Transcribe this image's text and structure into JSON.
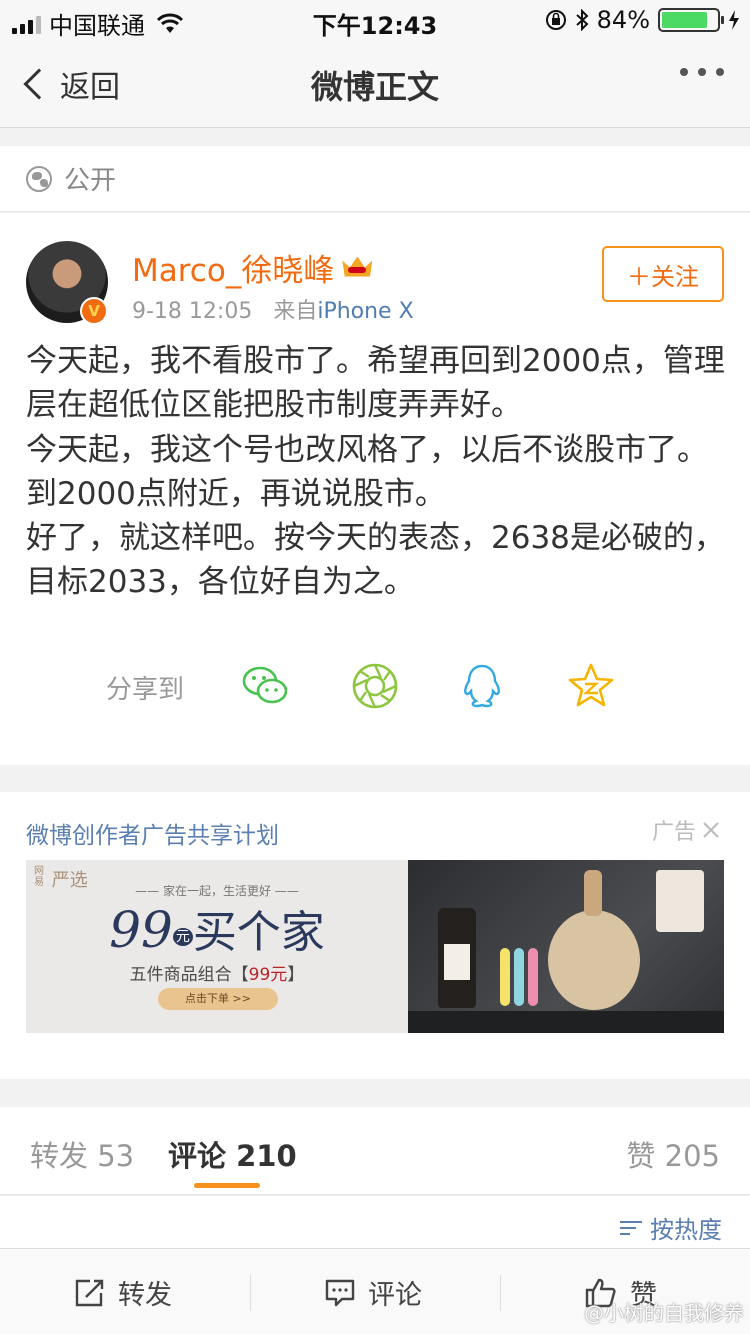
{
  "status_bar": {
    "carrier": "中国联通",
    "time": "下午12:43",
    "battery_percent": "84%",
    "battery_level": 0.84
  },
  "nav": {
    "back_label": "返回",
    "title": "微博正文"
  },
  "visibility": {
    "label": "公开"
  },
  "post": {
    "author": "Marco_徐晓峰",
    "time": "9-18 12:05",
    "from_prefix": "来自",
    "source": "iPhone X",
    "follow_label": "＋关注",
    "verified_badge": "V",
    "paragraphs": [
      "今天起，我不看股市了。希望再回到2000点，管理层在超低位区能把股市制度弄弄好。",
      "今天起，我这个号也改风格了，以后不谈股市了。到2000点附近，再说说股市。",
      "好了，就这样吧。按今天的表态，2638是必破的，目标2033，各位好自为之。"
    ],
    "share_label": "分享到",
    "share_targets": [
      "wechat-icon",
      "moments-icon",
      "qq-icon",
      "qzone-icon"
    ]
  },
  "ad": {
    "title": "微博创作者广告共享计划",
    "tag": "广告",
    "brand": "严选",
    "brand_small": "网易",
    "tagline": "—— 家在一起，生活更好 ——",
    "headline_num": "99",
    "headline_unit": "元",
    "headline_text": "买个家",
    "sub_text": "五件商品组合【",
    "sub_price": "99元",
    "sub_end": "】",
    "cta": "点击下单 >>"
  },
  "tabs": {
    "repost": "转发 53",
    "comments": "评论 210",
    "likes": "赞 205"
  },
  "sort": {
    "label": "按热度"
  },
  "bottom_bar": {
    "repost": "转发",
    "comment": "评论",
    "like": "赞"
  },
  "watermark": "@小树的自我修养",
  "colors": {
    "accent": "#f26b11",
    "follow_border": "#f7911d",
    "link_blue": "#507daf",
    "battery_green": "#4cd964"
  }
}
